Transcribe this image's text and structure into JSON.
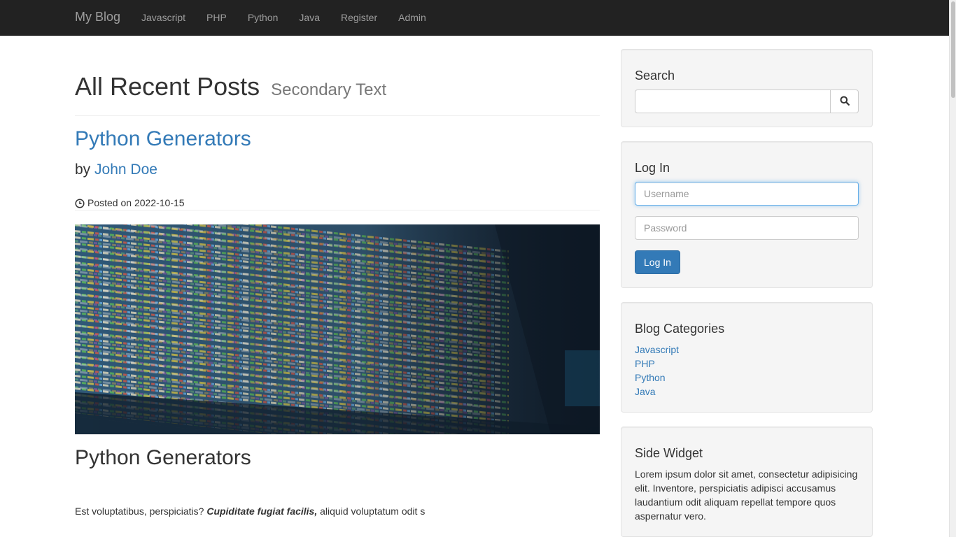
{
  "navbar": {
    "brand": "My Blog",
    "links": [
      "Javascript",
      "PHP",
      "Python",
      "Java",
      "Register",
      "Admin"
    ]
  },
  "main": {
    "page_title": "All Recent Posts",
    "page_subtitle": "Secondary Text",
    "post": {
      "title": "Python Generators",
      "by_prefix": "by",
      "author": "John Doe",
      "posted_prefix": "Posted on",
      "date": "2022-10-15",
      "heading": "Python Generators",
      "body_start": "Est voluptatibus, perspiciatis?",
      "body_emphasis": "Cupiditate fugiat facilis,",
      "body_end": "aliquid voluptatum odit s"
    }
  },
  "sidebar": {
    "search": {
      "title": "Search",
      "value": "",
      "icon": "search-icon"
    },
    "login": {
      "title": "Log In",
      "username_placeholder": "Username",
      "password_placeholder": "Password",
      "button_label": "Log In"
    },
    "categories": {
      "title": "Blog Categories",
      "items": [
        "Javascript",
        "PHP",
        "Python",
        "Java"
      ]
    },
    "widget": {
      "title": "Side Widget",
      "text": "Lorem ipsum dolor sit amet, consectetur adipisicing elit. Inventore, perspiciatis adipisci accusamus laudantium odit aliquam repellat tempore quos aspernatur vero."
    }
  },
  "colors": {
    "navbar_bg": "#222222",
    "link": "#337ab7",
    "primary_button": "#337ab7",
    "well_bg": "#f5f5f5"
  }
}
